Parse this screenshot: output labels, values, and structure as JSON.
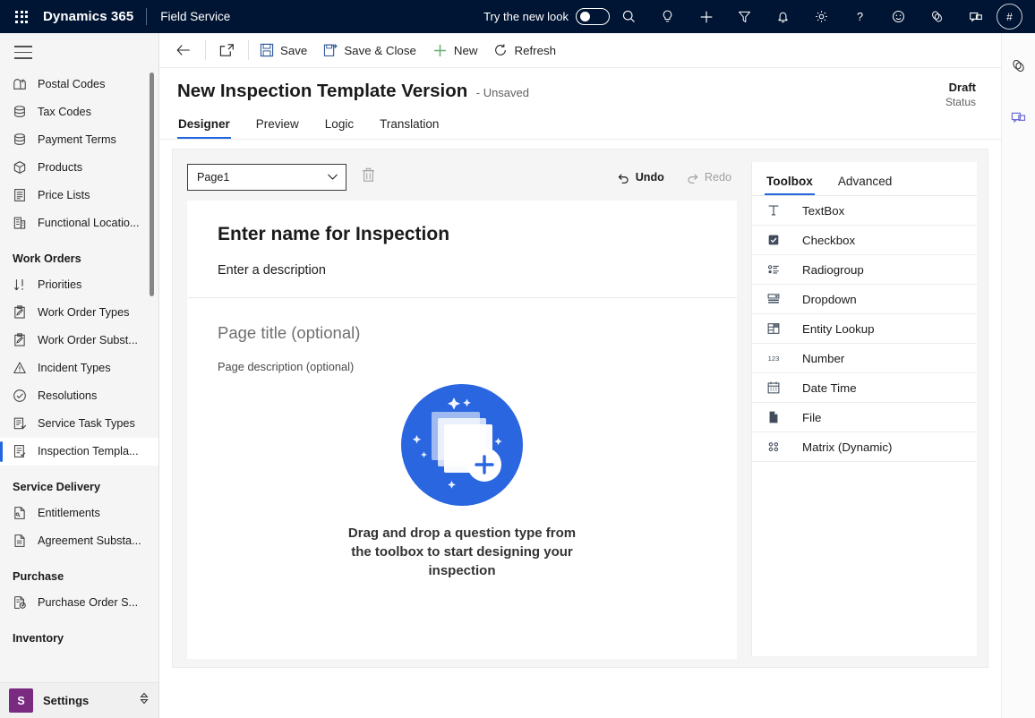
{
  "suitebar": {
    "waffle_label": "app-launcher",
    "brand": "Dynamics 365",
    "app_name": "Field Service",
    "new_look_label": "Try the new look",
    "new_look_on": false,
    "avatar_initial": "#",
    "icons": [
      "search-icon",
      "lightbulb-icon",
      "plus-icon",
      "filter-icon",
      "bell-icon",
      "gear-icon",
      "help-icon",
      "smiley-icon",
      "copilot-icon",
      "feedback-icon"
    ],
    "background": "#001433"
  },
  "sidebar": {
    "hamburger_label": "Show/hide navigation",
    "items": [
      {
        "label": "Postal Codes",
        "icon": "mailbox-icon",
        "type": "item",
        "selected": false
      },
      {
        "label": "Tax Codes",
        "icon": "database-icon",
        "type": "item",
        "selected": false
      },
      {
        "label": "Payment Terms",
        "icon": "database-icon",
        "type": "item",
        "selected": false
      },
      {
        "label": "Products",
        "icon": "box-icon",
        "type": "item",
        "selected": false
      },
      {
        "label": "Price Lists",
        "icon": "list-document-icon",
        "type": "item",
        "selected": false
      },
      {
        "label": "Functional Locatio...",
        "icon": "building-icon",
        "type": "item",
        "selected": false
      },
      {
        "label": "Work Orders",
        "type": "group"
      },
      {
        "label": "Priorities",
        "icon": "sort-icon",
        "type": "item",
        "selected": false
      },
      {
        "label": "Work Order Types",
        "icon": "clipboard-icon",
        "type": "item",
        "selected": false
      },
      {
        "label": "Work Order Subst...",
        "icon": "clipboard-icon",
        "type": "item",
        "selected": false
      },
      {
        "label": "Incident Types",
        "icon": "warning-triangle-icon",
        "type": "item",
        "selected": false
      },
      {
        "label": "Resolutions",
        "icon": "check-circle-icon",
        "type": "item",
        "selected": false
      },
      {
        "label": "Service Task Types",
        "icon": "task-icon",
        "type": "item",
        "selected": false
      },
      {
        "label": "Inspection Templa...",
        "icon": "inspection-icon",
        "type": "item",
        "selected": true
      },
      {
        "label": "Service Delivery",
        "type": "group"
      },
      {
        "label": "Entitlements",
        "icon": "entitlement-icon",
        "type": "item",
        "selected": false
      },
      {
        "label": "Agreement Substa...",
        "icon": "document-icon",
        "type": "item",
        "selected": false
      },
      {
        "label": "Purchase",
        "type": "group"
      },
      {
        "label": "Purchase Order S...",
        "icon": "purchase-order-icon",
        "type": "item",
        "selected": false
      },
      {
        "label": "Inventory",
        "type": "group"
      }
    ],
    "footer": {
      "badge": "S",
      "label": "Settings",
      "chevron": "chevron-updown-icon"
    },
    "accent": "#2266e3"
  },
  "commandbar": {
    "back_label": "back-arrow-icon",
    "popout_label": "open-in-new-window-icon",
    "buttons": [
      {
        "label": "Save",
        "icon": "save-icon"
      },
      {
        "label": "Save & Close",
        "icon": "save-close-icon"
      },
      {
        "label": "New",
        "icon": "plus-icon"
      },
      {
        "label": "Refresh",
        "icon": "refresh-icon"
      }
    ]
  },
  "record": {
    "title": "New Inspection Template Version",
    "subtitle": "- Unsaved",
    "status_value": "Draft",
    "status_caption": "Status"
  },
  "tabs": [
    {
      "label": "Designer",
      "active": true
    },
    {
      "label": "Preview",
      "active": false
    },
    {
      "label": "Logic",
      "active": false
    },
    {
      "label": "Translation",
      "active": false
    }
  ],
  "designer": {
    "page_select_value": "Page1",
    "page_select_options": [
      "Page1"
    ],
    "delete_page_label": "trash-icon",
    "undo_label": "Undo",
    "redo_label": "Redo",
    "undo_enabled": true,
    "redo_enabled": false,
    "inspection_name_placeholder": "Enter name for Inspection",
    "inspection_description_placeholder": "Enter a description",
    "page_title_placeholder": "Page title (optional)",
    "page_description_placeholder": "Page description (optional)",
    "empty_state_text": "Drag and drop a question type from the toolbox to start designing your inspection",
    "empty_state_icon": "add-cards-illustration",
    "illustration_color": "#2a66e0"
  },
  "toolbox": {
    "tabs": [
      {
        "label": "Toolbox",
        "active": true
      },
      {
        "label": "Advanced",
        "active": false
      }
    ],
    "items": [
      {
        "label": "TextBox",
        "icon": "textbox-icon"
      },
      {
        "label": "Checkbox",
        "icon": "checkbox-icon"
      },
      {
        "label": "Radiogroup",
        "icon": "radiogroup-icon"
      },
      {
        "label": "Dropdown",
        "icon": "dropdown-icon"
      },
      {
        "label": "Entity Lookup",
        "icon": "entity-lookup-icon"
      },
      {
        "label": "Number",
        "icon": "number-icon"
      },
      {
        "label": "Date Time",
        "icon": "calendar-icon"
      },
      {
        "label": "File",
        "icon": "file-icon"
      },
      {
        "label": "Matrix (Dynamic)",
        "icon": "matrix-icon"
      }
    ]
  },
  "rightrail": {
    "icons": [
      "copilot-icon",
      "assistant-chat-icon"
    ]
  }
}
